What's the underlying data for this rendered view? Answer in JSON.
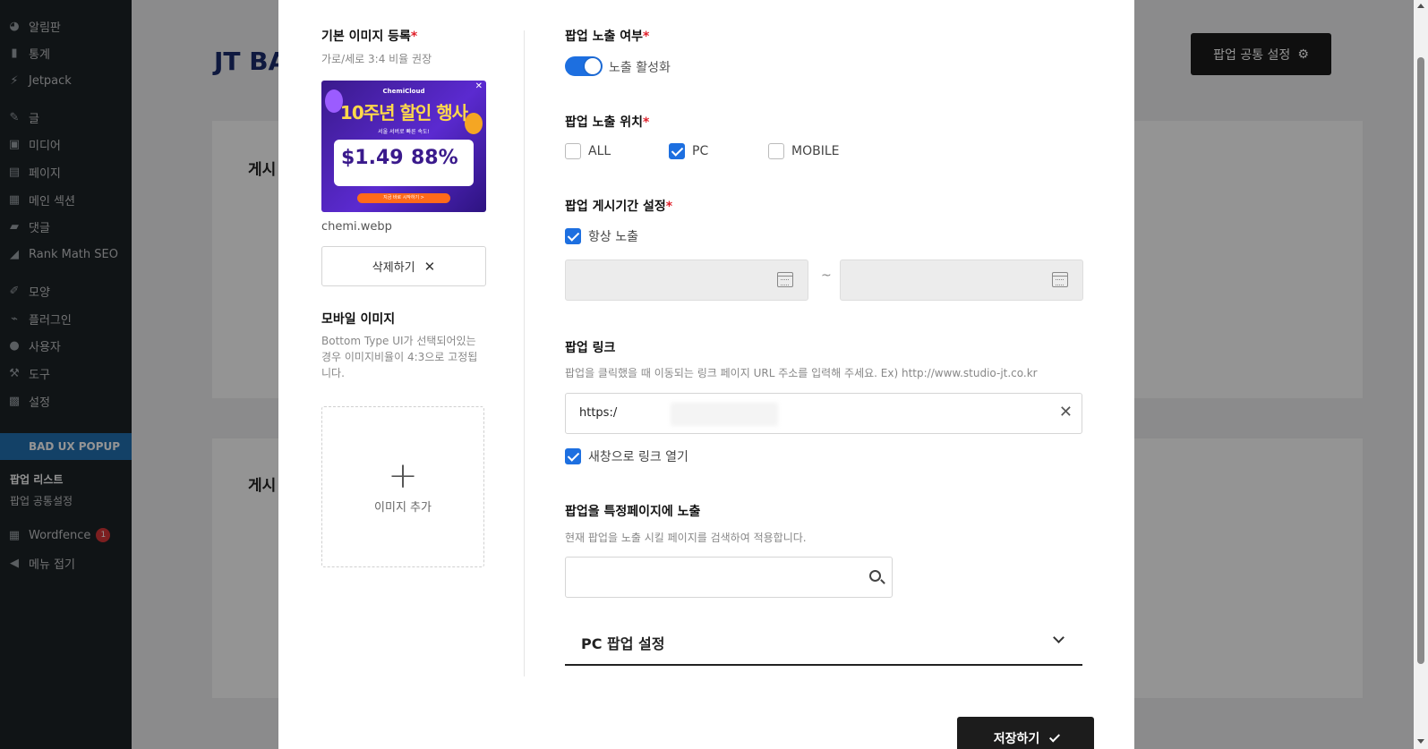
{
  "sidebar": {
    "items": [
      {
        "label": "알림판",
        "icon": "dashboard-icon"
      },
      {
        "label": "통계",
        "icon": "stats-icon"
      },
      {
        "label": "Jetpack",
        "icon": "jetpack-icon"
      },
      {
        "label": "글",
        "icon": "pin-icon"
      },
      {
        "label": "미디어",
        "icon": "media-icon"
      },
      {
        "label": "페이지",
        "icon": "page-icon"
      },
      {
        "label": "메인 섹션",
        "icon": "grid-icon"
      },
      {
        "label": "댓글",
        "icon": "comment-icon"
      },
      {
        "label": "Rank Math SEO",
        "icon": "rankmath-icon"
      },
      {
        "label": "모양",
        "icon": "brush-icon"
      },
      {
        "label": "플러그인",
        "icon": "plugin-icon"
      },
      {
        "label": "사용자",
        "icon": "user-icon"
      },
      {
        "label": "도구",
        "icon": "wrench-icon"
      },
      {
        "label": "설정",
        "icon": "settings-icon"
      },
      {
        "label": "BAD UX POPUP",
        "icon": "popup-icon"
      }
    ],
    "sub_items": [
      "팝업 리스트",
      "팝업 공통설정"
    ],
    "wordfence": {
      "label": "Wordfence",
      "badge": "1"
    },
    "collapse": "메뉴 접기"
  },
  "background": {
    "title": "JT BA",
    "common_settings_button": "팝업 공통 설정",
    "card_label_1": "게시",
    "card_label_2": "게시"
  },
  "modal": {
    "left": {
      "base_image_title": "기본 이미지 등록",
      "base_image_hint": "가로/세로 3:4 비율 권장",
      "file_name": "chemi.webp",
      "delete_button": "삭제하기",
      "thumbnail": {
        "brand": "ChemiCloud",
        "headline": "10주년 할인 행사",
        "sub": "서울 서버로 빠른 속도!",
        "price1": "$1.49",
        "price2": "88%",
        "cta": "지금 바로 시작하기 >"
      },
      "mobile_image_title": "모바일 이미지",
      "mobile_image_hint": "Bottom Type UI가 선택되어있는 경우 이미지비율이 4:3으로 고정됩니다.",
      "add_image_label": "이미지 추가"
    },
    "right": {
      "visibility_title": "팝업 노출 여부",
      "visibility_toggle_label": "노출 활성화",
      "visibility_enabled": true,
      "position_title": "팝업 노출 위치",
      "position_options": [
        {
          "label": "ALL",
          "checked": false
        },
        {
          "label": "PC",
          "checked": true
        },
        {
          "label": "MOBILE",
          "checked": false
        }
      ],
      "period_title": "팝업 게시기간 설정",
      "always_show_label": "항상 노출",
      "always_show_checked": true,
      "date_separator": "~",
      "link_title": "팝업 링크",
      "link_hint": "팝업을 클릭했을 때 이동되는 링크 페이지 URL 주소를 입력해 주세요. Ex) http://www.studio-jt.co.kr",
      "link_value": "https:/",
      "new_window_label": "새창으로 링크 열기",
      "new_window_checked": true,
      "specific_page_title": "팝업을 특정페이지에 노출",
      "specific_page_hint": "현재 팝업을 노출 시킬 페이지를 검색하여 적용합니다.",
      "accordion_title": "PC 팝업 설정"
    },
    "save_button": "저장하기"
  },
  "colors": {
    "accent": "#1d6fe0",
    "required": "#e0202a",
    "dark_button": "#1c1c1c"
  }
}
